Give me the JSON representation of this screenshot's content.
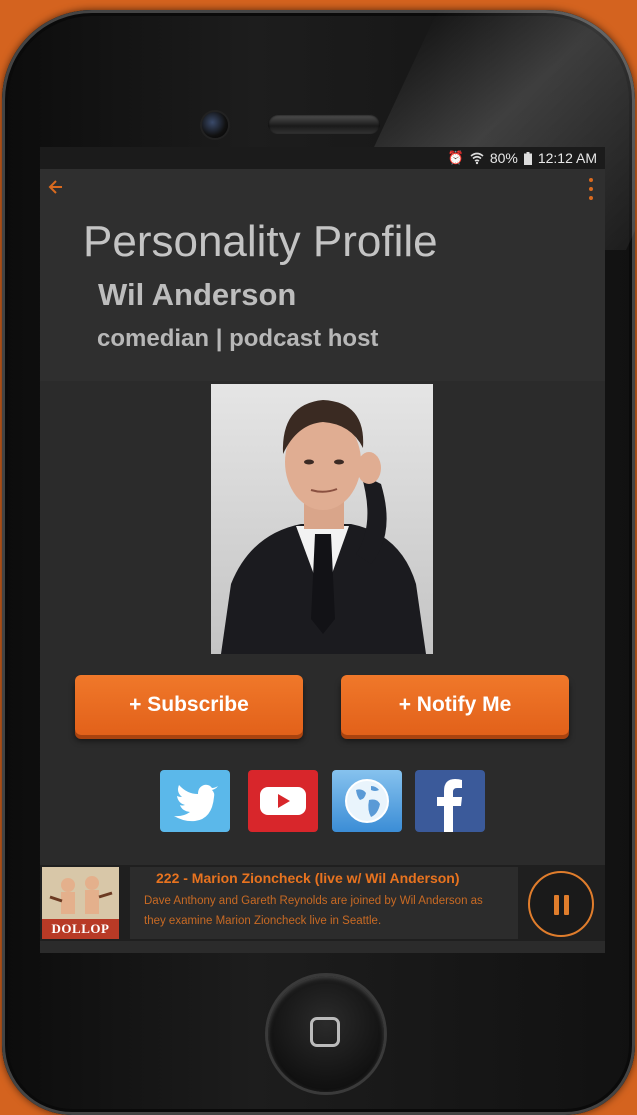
{
  "status_bar": {
    "battery": "80%",
    "time": "12:12 AM",
    "icons": [
      "alarm-icon",
      "wifi-icon",
      "battery-icon"
    ]
  },
  "app_bar": {
    "icons": [
      "back-arrow-icon",
      "overflow-menu-icon"
    ],
    "accent_color": "#d96a1f"
  },
  "header": {
    "title": "Personality Profile",
    "name": "Wil Anderson",
    "role": "comedian | podcast host"
  },
  "actions": {
    "subscribe_label": "+ Subscribe",
    "notify_label": "+ Notify Me",
    "button_color": "#f0782a"
  },
  "social": {
    "icons": [
      "twitter-icon",
      "youtube-icon",
      "website-globe-icon",
      "facebook-icon"
    ]
  },
  "player": {
    "art_label": "DOLLOP",
    "episode_title": "222 - Marion Zioncheck (live w/ Wil Anderson)",
    "episode_description": "Dave Anthony and Gareth Reynolds are joined by Wil Anderson as they examine Marion Zioncheck live in Seattle.",
    "control": "pause-icon",
    "accent_color": "#e8731f"
  }
}
